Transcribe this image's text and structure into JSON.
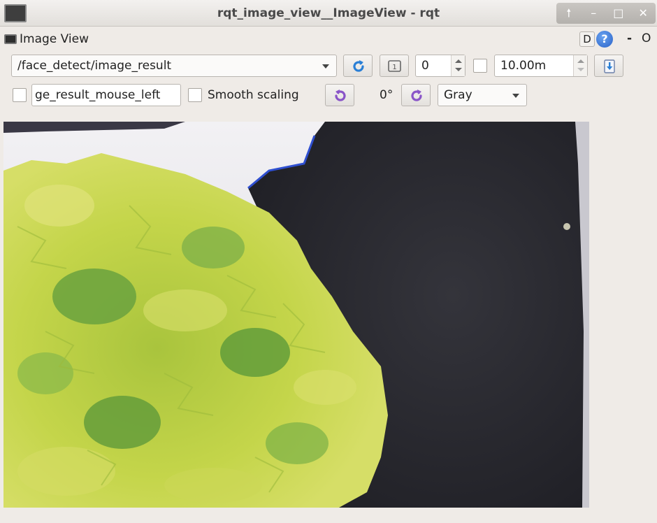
{
  "window": {
    "title": "rqt_image_view__ImageView - rqt",
    "controls": [
      "up-icon",
      "minimize-icon",
      "maximize-icon",
      "close-icon"
    ]
  },
  "plugin": {
    "title": "Image View",
    "d_label": "D",
    "help_label": "?",
    "dash_label": "-",
    "o_label": "O"
  },
  "toolbar": {
    "topic": "/face_detect/image_result",
    "refresh_icon": "refresh-icon",
    "zoom_one_icon": "zoom-one-icon",
    "queue_value": "0",
    "timeout_value": "10.00m",
    "save_icon": "save-icon"
  },
  "options": {
    "mouse_topic": "ge_result_mouse_left",
    "smooth_label": "Smooth scaling",
    "rotate_ccw_icon": "rotate-ccw-icon",
    "rotation": "0°",
    "rotate_cw_icon": "rotate-cw-icon",
    "color_scheme": "Gray"
  },
  "colors": {
    "accent_blue": "#2a7fd6",
    "accent_purple": "#8a55c8",
    "foliage_light": "#c8d64a",
    "foliage_dark": "#5c9a3a",
    "dark_object": "#2b2b32"
  }
}
